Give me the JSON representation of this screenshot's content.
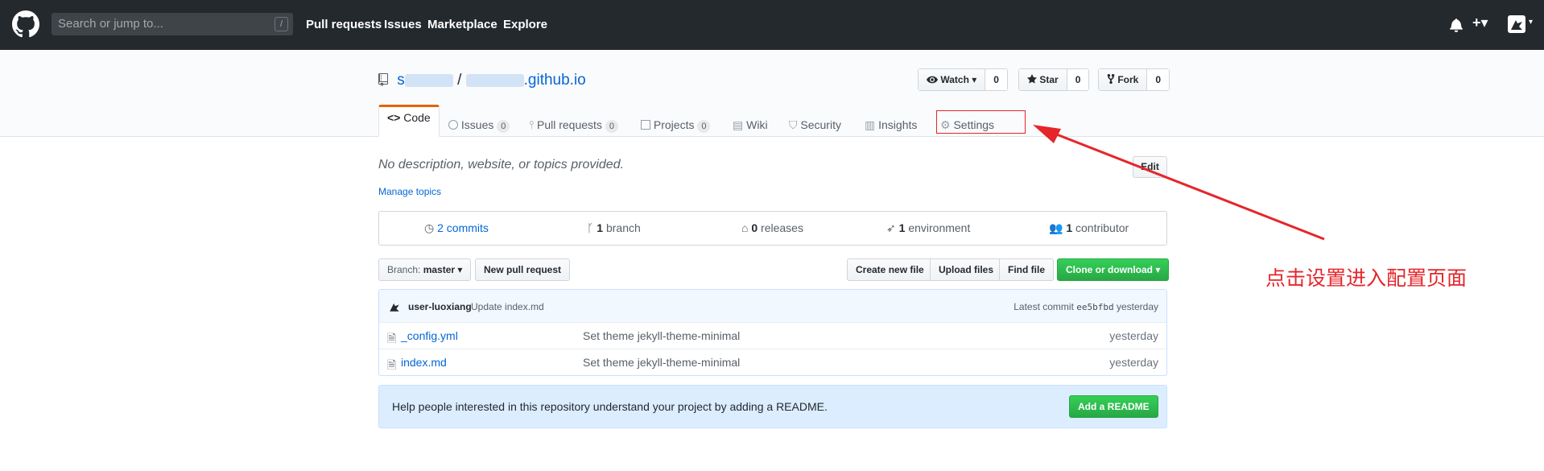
{
  "header": {
    "search_placeholder": "Search or jump to...",
    "search_shortcut": "/",
    "nav": [
      "Pull requests",
      "Issues",
      "Marketplace",
      "Explore"
    ],
    "plus_label": "+▾"
  },
  "repo": {
    "owner_visible": "s",
    "separator": "/",
    "name_visible": ".github.io",
    "watch_label": "Watch ▾",
    "watch_count": "0",
    "star_label": "Star",
    "star_count": "0",
    "fork_label": "Fork",
    "fork_count": "0"
  },
  "tabs": [
    {
      "label": "Code"
    },
    {
      "label": "Issues",
      "count": "0"
    },
    {
      "label": "Pull requests",
      "count": "0"
    },
    {
      "label": "Projects",
      "count": "0"
    },
    {
      "label": "Wiki"
    },
    {
      "label": "Security"
    },
    {
      "label": "Insights"
    },
    {
      "label": "Settings"
    }
  ],
  "description": "No description, website, or topics provided.",
  "manage_topics": "Manage topics",
  "edit_label": "Edit",
  "summary": {
    "commits_count": "2",
    "commits_label": "commits",
    "branch_count": "1",
    "branch_label": "branch",
    "releases_count": "0",
    "releases_label": "releases",
    "env_count": "1",
    "env_label": "environment",
    "contrib_count": "1",
    "contrib_label": "contributor"
  },
  "toolbar": {
    "branch_prefix": "Branch:",
    "branch_name": "master ▾",
    "new_pr": "New pull request",
    "create_file": "Create new file",
    "upload": "Upload files",
    "find": "Find file",
    "clone": "Clone or download ▾"
  },
  "commit": {
    "author": "user-luoxiang",
    "message": "Update index.md",
    "latest_label": "Latest commit",
    "sha": "ee5bfbd",
    "time": "yesterday"
  },
  "files": [
    {
      "name": "_config.yml",
      "message": "Set theme jekyll-theme-minimal",
      "age": "yesterday"
    },
    {
      "name": "index.md",
      "message": "Set theme jekyll-theme-minimal",
      "age": "yesterday"
    }
  ],
  "readme": {
    "text": "Help people interested in this repository understand your project by adding a README.",
    "button": "Add a README"
  },
  "annotation": "点击设置进入配置页面",
  "colors": {
    "header_bg": "#24292e",
    "link": "#0366d6",
    "green": "#28a745",
    "annotation_red": "#e5262b",
    "tab_accent": "#e36209"
  }
}
